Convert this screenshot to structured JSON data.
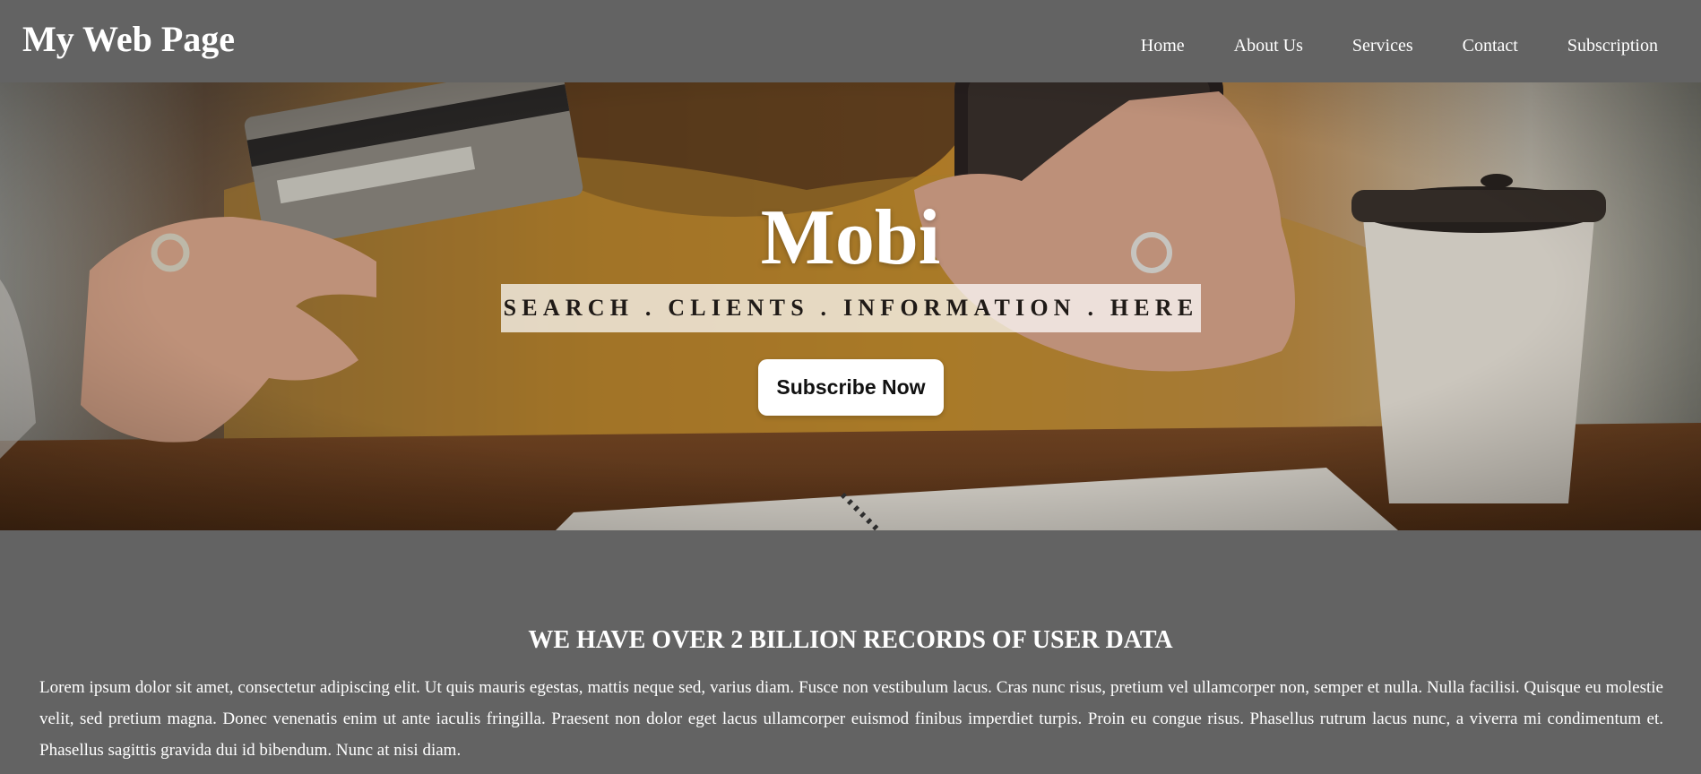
{
  "header": {
    "brand": "My Web Page",
    "nav": [
      {
        "label": "Home"
      },
      {
        "label": "About Us"
      },
      {
        "label": "Services"
      },
      {
        "label": "Contact"
      },
      {
        "label": "Subscription"
      }
    ]
  },
  "hero": {
    "title": "Mobi",
    "tagline": "SEARCH . CLIENTS . INFORMATION . HERE",
    "cta_label": "Subscribe Now"
  },
  "section": {
    "heading": "WE HAVE OVER 2 BILLION RECORDS OF USER DATA",
    "body": "Lorem ipsum dolor sit amet, consectetur adipiscing elit. Ut quis mauris egestas, mattis neque sed, varius diam. Fusce non vestibulum lacus. Cras nunc risus, pretium vel ullamcorper non, semper et nulla. Nulla facilisi. Quisque eu molestie velit, sed pretium magna. Donec venenatis enim ut ante iaculis fringilla. Praesent non dolor eget lacus ullamcorper euismod finibus imperdiet turpis. Proin eu congue risus. Phasellus rutrum lacus nunc, a viverra mi condimentum et. Phasellus sagittis gravida dui id bibendum. Nunc at nisi diam."
  },
  "colors": {
    "page_background": "#636363",
    "text": "#ffffff",
    "tagline_background": "#ffffffb8",
    "button_background": "#ffffff"
  },
  "icons": {
    "hero_image": "hero-photo-card-phone-coffee"
  }
}
